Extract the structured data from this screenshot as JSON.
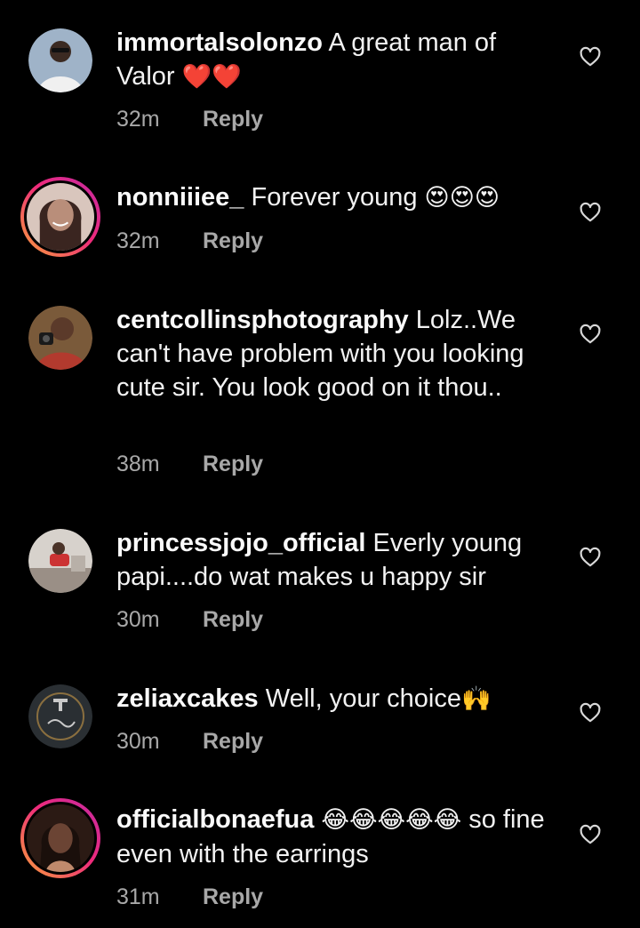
{
  "comments": [
    {
      "username": "immortalsolonzo",
      "text": "A great man of Valor",
      "emoji": "❤️❤️",
      "time": "32m",
      "reply": "Reply",
      "avatar_colors": [
        "#9fb3c8",
        "#f0f0f0",
        "#2a2a2a"
      ]
    },
    {
      "username": "nonniiiee_",
      "text": "Forever young",
      "emoji": "😍😍😍",
      "time": "32m",
      "reply": "Reply",
      "avatar_colors": [
        "#b98e7a",
        "#3a2520",
        "#d9c6bd"
      ]
    },
    {
      "username": "centcollinsphotography",
      "text": "Lolz..We can't have problem with you looking cute sir. You look good on it thou..",
      "emoji": "",
      "time": "38m",
      "reply": "Reply",
      "avatar_colors": [
        "#5b3a2a",
        "#b23a2e",
        "#1a1a1a"
      ]
    },
    {
      "username": "princessjojo_official",
      "text": "Everly young papi....do wat makes u happy sir",
      "emoji": "",
      "time": "30m",
      "reply": "Reply",
      "avatar_colors": [
        "#d7d2cc",
        "#9a8f86",
        "#c33"
      ]
    },
    {
      "username": "zeliaxcakes",
      "text": "Well, your choice",
      "emoji": "🙌",
      "time": "30m",
      "reply": "Reply",
      "avatar_colors": [
        "#2a2f33",
        "#c9c9c9",
        "#8a6f3f"
      ]
    },
    {
      "username": "officialbonaefua",
      "text": "",
      "emoji": "😂😂😂😂😂",
      "text_after": "so fine even with the earrings",
      "time": "31m",
      "reply": "Reply",
      "avatar_colors": [
        "#6b4434",
        "#2b1a14",
        "#c08a6c"
      ]
    }
  ]
}
